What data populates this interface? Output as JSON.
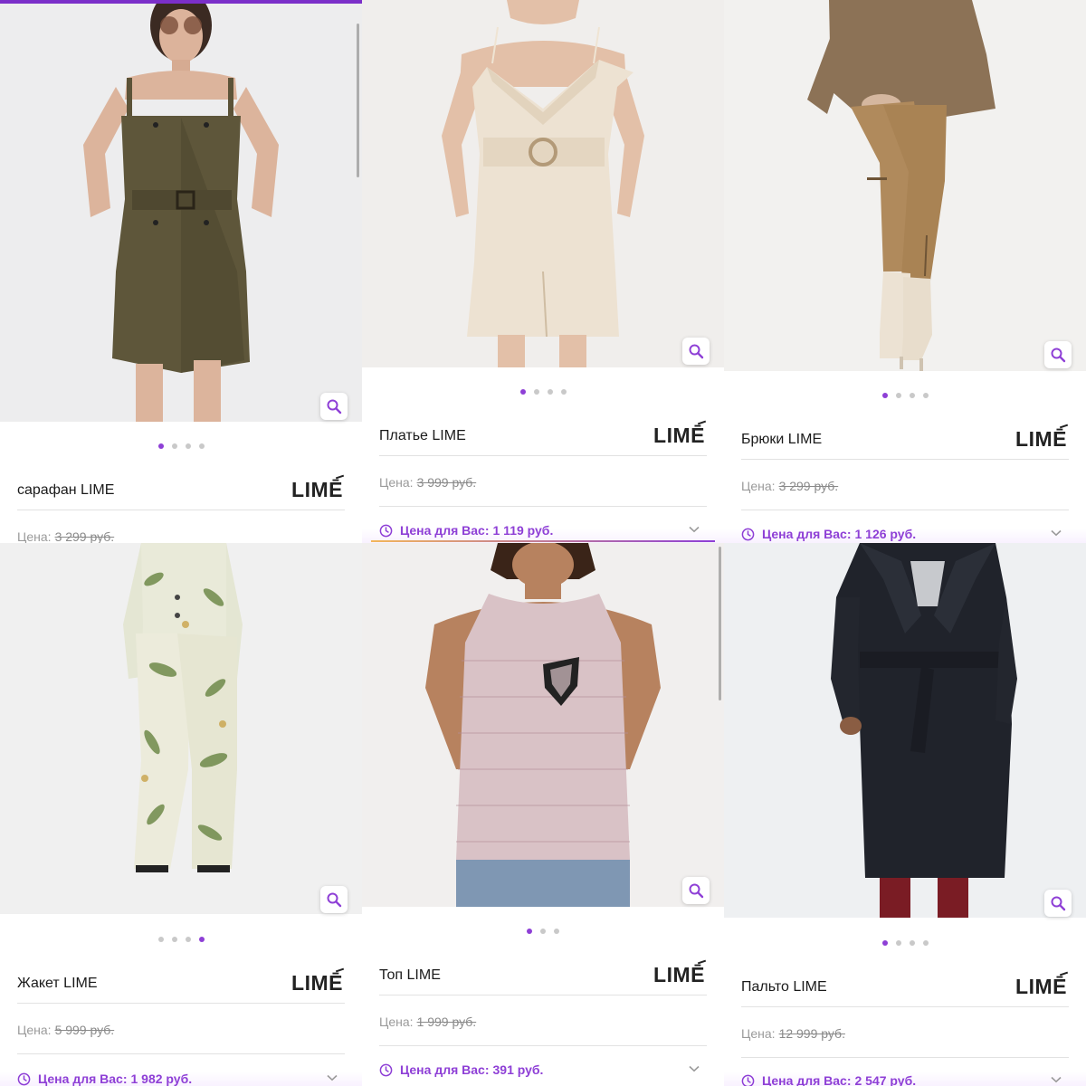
{
  "labels": {
    "price_prefix": "Цена:",
    "offer_prefix": "Цена для Вас:"
  },
  "colors": {
    "accent": "#8e3fd6",
    "dot_inactive": "#c9c9c9",
    "divider": "#e2e2e2"
  },
  "icons": {
    "zoom": "magnifier-icon",
    "offer": "clock-icon",
    "expand": "chevron-down-icon"
  },
  "products": [
    {
      "title": "сарафан LIME",
      "brand": "LIMĒ",
      "old_price": "3 299 руб.",
      "offer_price": "",
      "image_count": 4,
      "active_image": 1,
      "image": "olive pinstripe double-breasted pinafore dress with belt"
    },
    {
      "title": "Платье LIME",
      "brand": "LIMĒ",
      "old_price": "3 999 руб.",
      "offer_price": "1 119 руб.",
      "image_count": 4,
      "active_image": 1,
      "image": "cream off-shoulder dress with ring belt"
    },
    {
      "title": "Брюки LIME",
      "brand": "LIMĒ",
      "old_price": "3 299 руб.",
      "offer_price": "1 126 руб.",
      "image_count": 4,
      "active_image": 1,
      "image": "camel cargo trousers with knit sweater"
    },
    {
      "title": "Жакет LIME",
      "brand": "LIMĒ",
      "old_price": "5 999 руб.",
      "offer_price": "1 982 руб.",
      "image_count": 4,
      "active_image": 4,
      "image": "botanical print suit"
    },
    {
      "title": "Топ LIME",
      "brand": "LIMĒ",
      "old_price": "1 999 руб.",
      "offer_price": "391 руб.",
      "image_count": 3,
      "active_image": 1,
      "image": "pink tweed sleeveless top with patch"
    },
    {
      "title": "Пальто LIME",
      "brand": "LIMĒ",
      "old_price": "12 999 руб.",
      "offer_price": "2 547 руб.",
      "image_count": 4,
      "active_image": 1,
      "image": "black belted wool coat"
    }
  ]
}
